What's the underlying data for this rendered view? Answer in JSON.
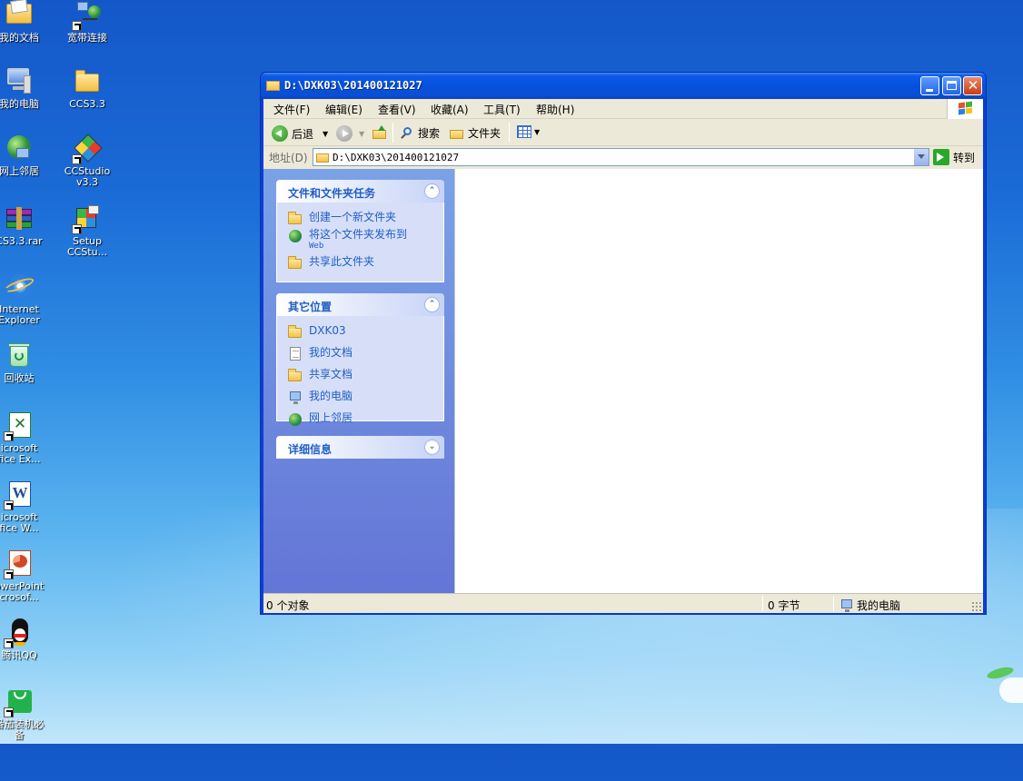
{
  "desktop": {
    "icons": [
      {
        "label": "我的文档"
      },
      {
        "label": "宽带连接"
      },
      {
        "label": "我的电脑"
      },
      {
        "label": "CCS3.3"
      },
      {
        "label": "网上邻居"
      },
      {
        "label": "CCStudio\nv3.3"
      },
      {
        "label": "CS3.3.rar"
      },
      {
        "label": "Setup\nCCStu..."
      },
      {
        "label": "Internet\nExplorer"
      },
      {
        "label": "回收站"
      },
      {
        "label": "icrosoft\nfice Ex..."
      },
      {
        "label": "icrosoft\nfice W..."
      },
      {
        "label": "owerPoint\ncrosof..."
      },
      {
        "label": "腾讯QQ"
      },
      {
        "label": "番茄装机必\n备"
      }
    ]
  },
  "window": {
    "title": "D:\\DXK03\\201400121027",
    "menu": [
      "文件(F)",
      "编辑(E)",
      "查看(V)",
      "收藏(A)",
      "工具(T)",
      "帮助(H)"
    ],
    "toolbar": {
      "back": "后退",
      "search": "搜索",
      "folders": "文件夹"
    },
    "address": {
      "label": "地址(D)",
      "value": "D:\\DXK03\\201400121027",
      "go": "转到"
    },
    "tasks_panel": {
      "title": "文件和文件夹任务",
      "items": [
        "创建一个新文件夹",
        "将这个文件夹发布到",
        "共享此文件夹"
      ],
      "item2_sub": "Web"
    },
    "places_panel": {
      "title": "其它位置",
      "items": [
        "DXK03",
        "我的文档",
        "共享文档",
        "我的电脑",
        "网上邻居"
      ]
    },
    "details_panel": {
      "title": "详细信息"
    },
    "status": {
      "objects": "0 个对象",
      "size": "0 字节",
      "location": "我的电脑"
    }
  },
  "colors": {
    "title_blue": "#0651dd",
    "link_blue": "#215dc6",
    "sidepane": "#7ba2e7"
  }
}
